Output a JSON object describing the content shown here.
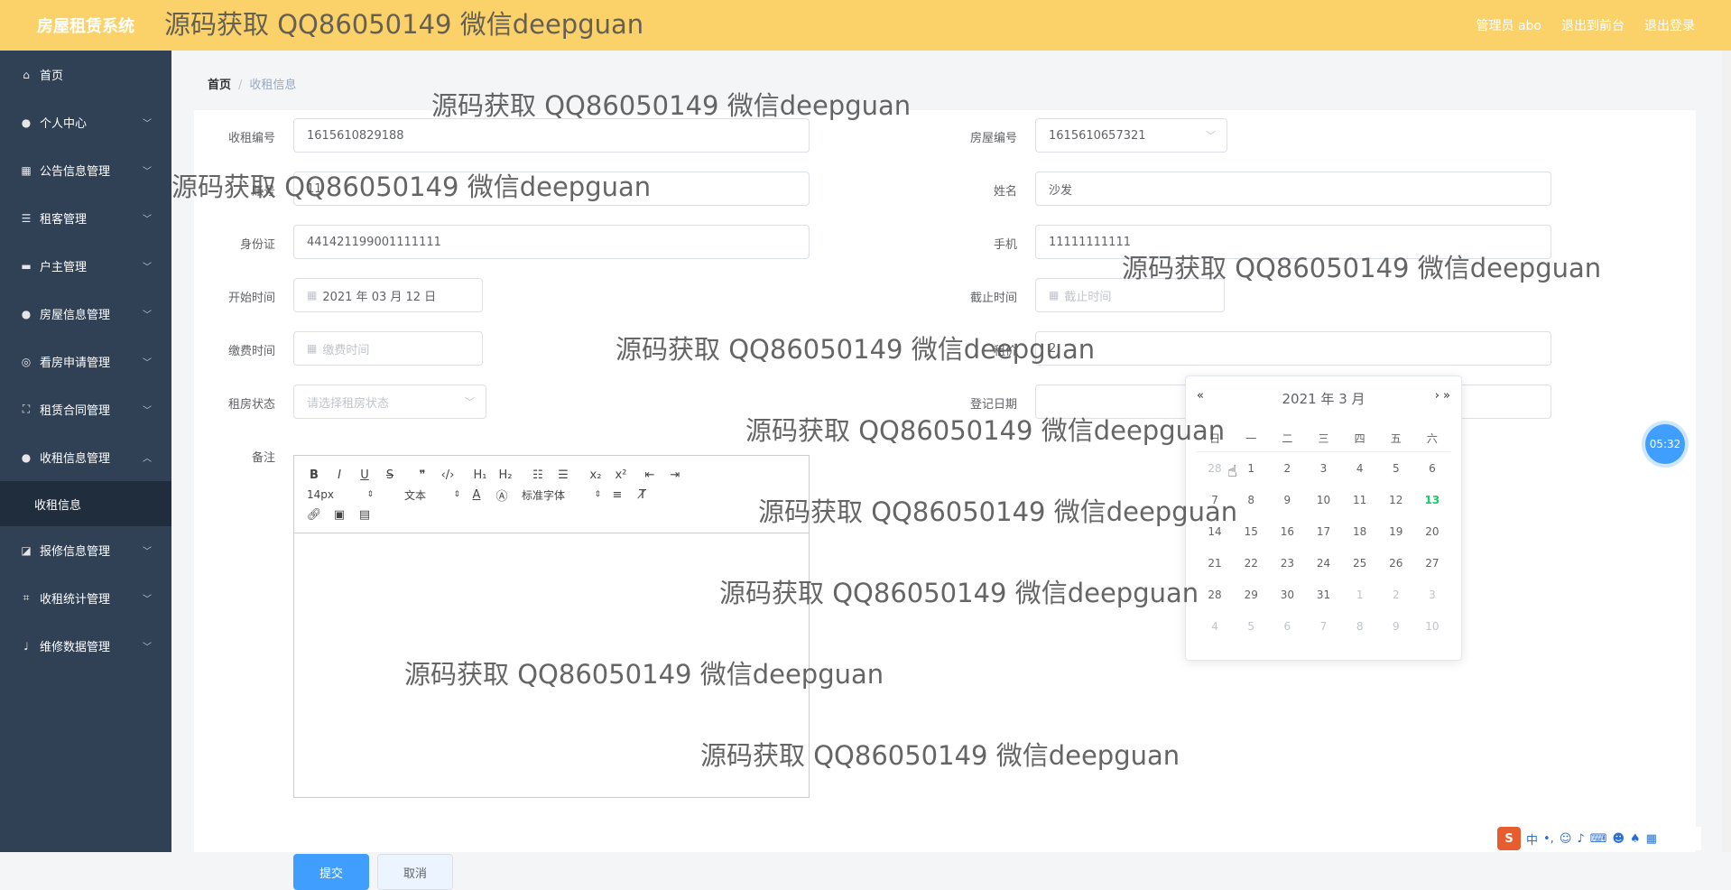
{
  "app": {
    "title": "房屋租赁系统",
    "admin": "管理员 abo",
    "to_front": "退出到前台",
    "logout": "退出登录"
  },
  "sidebar": {
    "items": [
      {
        "label": "首页",
        "icon": "home-icon"
      },
      {
        "label": "个人中心",
        "icon": "user-icon"
      },
      {
        "label": "公告信息管理",
        "icon": "grid-icon"
      },
      {
        "label": "租客管理",
        "icon": "list-icon"
      },
      {
        "label": "户主管理",
        "icon": "briefcase-icon"
      },
      {
        "label": "房屋信息管理",
        "icon": "user-icon"
      },
      {
        "label": "看房申请管理",
        "icon": "compass-icon"
      },
      {
        "label": "租赁合同管理",
        "icon": "frame-icon"
      },
      {
        "label": "收租信息管理",
        "icon": "user-icon"
      },
      {
        "label": "报修信息管理",
        "icon": "chart-icon"
      },
      {
        "label": "收租统计管理",
        "icon": "crop-icon"
      },
      {
        "label": "维修数据管理",
        "icon": "mic-icon"
      }
    ],
    "sub_item": "收租信息"
  },
  "breadcrumb": {
    "home": "首页",
    "sep": "/",
    "current": "收租信息"
  },
  "form": {
    "rent_no_label": "收租编号",
    "rent_no": "1615610829188",
    "house_no_label": "房屋编号",
    "house_no": "1615610657321",
    "account_label": "账号",
    "account": "11",
    "name_label": "姓名",
    "name": "沙发",
    "id_label": "身份证",
    "id": "441421199001111111",
    "phone_label": "手机",
    "phone": "11111111111",
    "start_label": "开始时间",
    "start": "2021 年 03 月 12 日",
    "end_label": "截止时间",
    "end_placeholder": "截止时间",
    "pay_label": "缴费时间",
    "pay_placeholder": "缴费时间",
    "rent_label": "租价",
    "rent": "2",
    "status_label": "租房状态",
    "status_placeholder": "请选择租房状态",
    "reg_label": "登记日期",
    "remark_label": "备注",
    "submit": "提交",
    "cancel": "取消"
  },
  "editor": {
    "font_size": "14px",
    "block": "文本",
    "font": "标准字体",
    "h1": "H₁",
    "h2": "H₂",
    "sub": "x₂",
    "sup": "x²"
  },
  "datepicker": {
    "header": "2021 年  3 月",
    "prev": "«",
    "next": "› »",
    "weekdays": [
      "日",
      "一",
      "二",
      "三",
      "四",
      "五",
      "六"
    ],
    "rows": [
      [
        {
          "d": "28",
          "o": true
        },
        {
          "d": "1"
        },
        {
          "d": "2"
        },
        {
          "d": "3"
        },
        {
          "d": "4"
        },
        {
          "d": "5"
        },
        {
          "d": "6"
        }
      ],
      [
        {
          "d": "7"
        },
        {
          "d": "8"
        },
        {
          "d": "9"
        },
        {
          "d": "10"
        },
        {
          "d": "11"
        },
        {
          "d": "12"
        },
        {
          "d": "13",
          "t": true
        }
      ],
      [
        {
          "d": "14"
        },
        {
          "d": "15"
        },
        {
          "d": "16"
        },
        {
          "d": "17"
        },
        {
          "d": "18"
        },
        {
          "d": "19"
        },
        {
          "d": "20"
        }
      ],
      [
        {
          "d": "21"
        },
        {
          "d": "22"
        },
        {
          "d": "23"
        },
        {
          "d": "24"
        },
        {
          "d": "25"
        },
        {
          "d": "26"
        },
        {
          "d": "27"
        }
      ],
      [
        {
          "d": "28"
        },
        {
          "d": "29"
        },
        {
          "d": "30"
        },
        {
          "d": "31"
        },
        {
          "d": "1",
          "o": true
        },
        {
          "d": "2",
          "o": true
        },
        {
          "d": "3",
          "o": true
        }
      ],
      [
        {
          "d": "4",
          "o": true
        },
        {
          "d": "5",
          "o": true
        },
        {
          "d": "6",
          "o": true
        },
        {
          "d": "7",
          "o": true
        },
        {
          "d": "8",
          "o": true
        },
        {
          "d": "9",
          "o": true
        },
        {
          "d": "10",
          "o": true
        }
      ]
    ]
  },
  "clock": "05:32",
  "ime": {
    "mode": "中"
  },
  "watermark": "源码获取 QQ86050149 微信deepguan",
  "colors": {
    "topbar": "#fbd26a",
    "sidebar": "#304156",
    "primary": "#409eff",
    "today": "#13ce66"
  }
}
